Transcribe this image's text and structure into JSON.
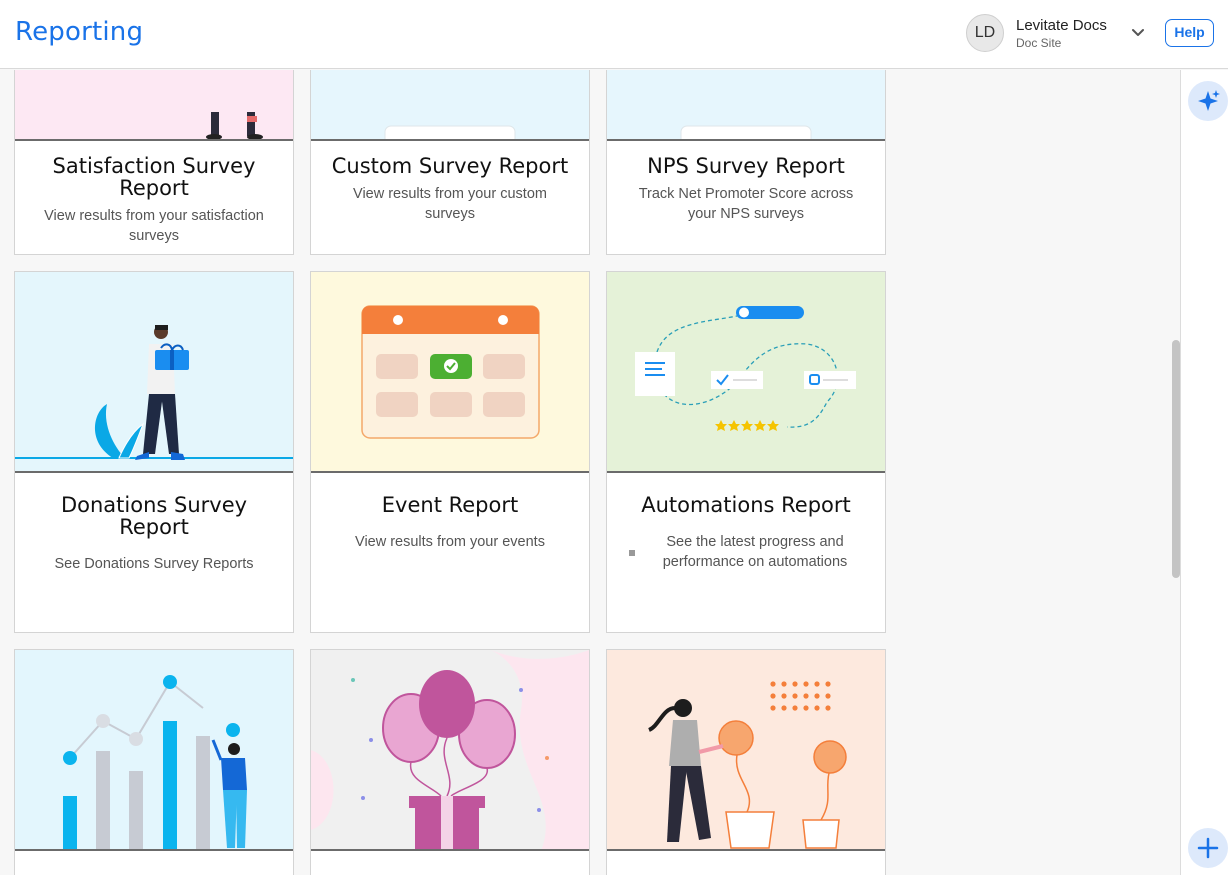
{
  "header": {
    "title": "Reporting",
    "avatar_initials": "LD",
    "account_name": "Levitate Docs",
    "account_site": "Doc Site",
    "help_label": "Help"
  },
  "cards": [
    {
      "title": "Satisfaction Survey Report",
      "description": "View results from your satisfaction surveys"
    },
    {
      "title": "Custom Survey Report",
      "description": "View results from your custom surveys"
    },
    {
      "title": "NPS Survey Report",
      "description": "Track Net Promoter Score across your NPS surveys"
    },
    {
      "title": "Donations Survey Report",
      "description": "See Donations Survey Reports"
    },
    {
      "title": "Event Report",
      "description": "View results from your events"
    },
    {
      "title": "Automations Report",
      "description": "See the latest progress and performance on automations"
    }
  ],
  "colors": {
    "accent": "#1a73e8",
    "brand_blue": "#0aa8e6",
    "orange": "#f47f3b",
    "green": "#4caf32",
    "pink": "#c0559c"
  },
  "icons": {
    "ai_assistant": "sparkle-icon",
    "add": "plus-icon",
    "account_menu": "chevron-down-icon"
  }
}
